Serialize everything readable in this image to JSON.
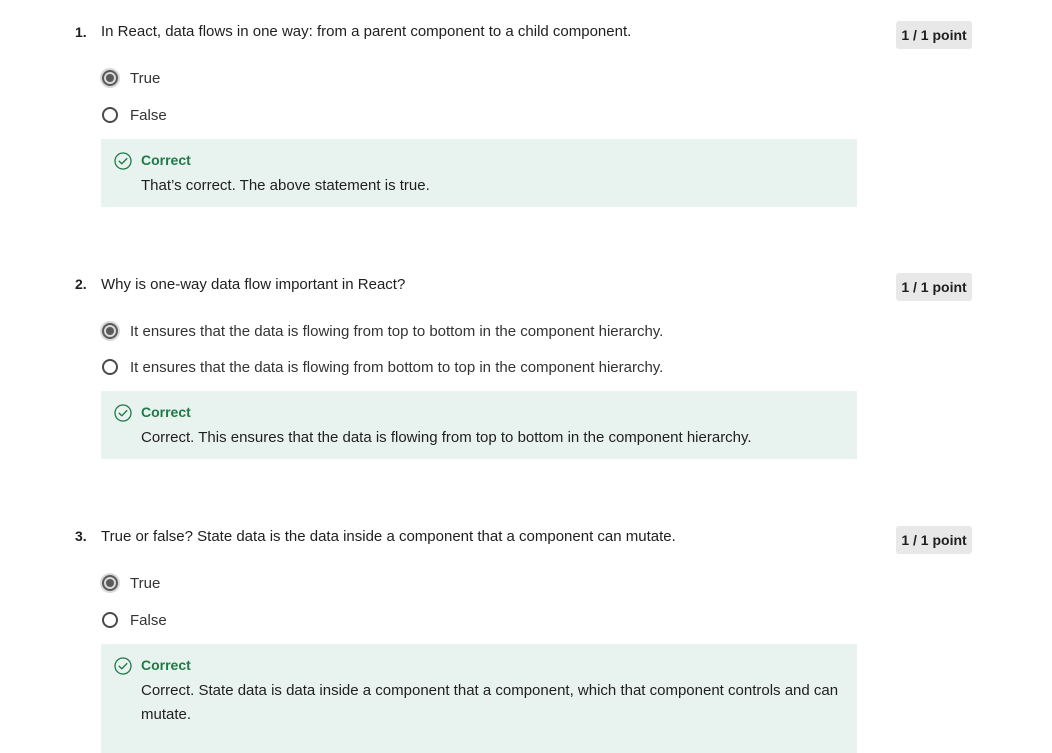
{
  "questions": [
    {
      "number": "1.",
      "text": "In React, data flows in one way: from a parent component to a child component.",
      "points": "1 / 1 point",
      "options": [
        {
          "label": "True",
          "selected": true
        },
        {
          "label": "False",
          "selected": false
        }
      ],
      "feedback": {
        "title": "Correct",
        "text": "That’s correct. The above statement is true."
      }
    },
    {
      "number": "2.",
      "text": "Why is one-way data flow important in React?",
      "points": "1 / 1 point",
      "options": [
        {
          "label": "It ensures that the data is flowing from top to bottom in the component hierarchy.",
          "selected": true
        },
        {
          "label": "It ensures that the data is flowing from bottom to top in the component hierarchy.",
          "selected": false
        }
      ],
      "feedback": {
        "title": "Correct",
        "text": "Correct. This ensures that the data is flowing from top to bottom in the component hierarchy."
      }
    },
    {
      "number": "3.",
      "text": "True or false? State data is the data inside a component that a component can mutate.",
      "points": "1 / 1 point",
      "options": [
        {
          "label": "True",
          "selected": true
        },
        {
          "label": "False",
          "selected": false
        }
      ],
      "feedback": {
        "title": "Correct",
        "text": "Correct. State data is data inside a component that a component, which that component controls and can mutate."
      }
    }
  ],
  "icons": {
    "correct": "check-circle-icon"
  },
  "colors": {
    "feedback_bg": "#e8f2ef",
    "correct_green": "#1e7b46",
    "points_badge_bg": "#e8e8e8"
  }
}
